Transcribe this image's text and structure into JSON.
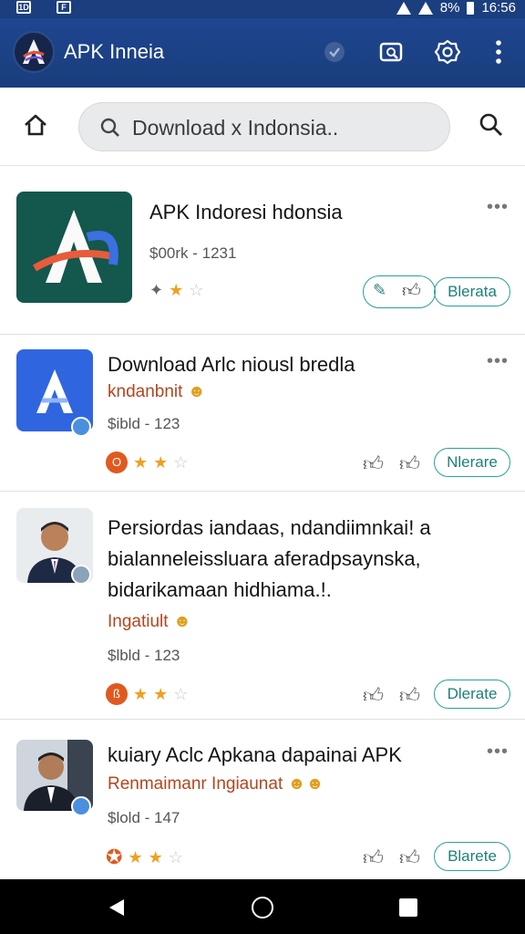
{
  "status_bar": {
    "left_icon_1": "1D",
    "left_icon_2": "F",
    "battery": "8%",
    "time": "16:56"
  },
  "app_bar": {
    "title": "APK Inneia",
    "icons": [
      "shield-check-icon",
      "screenshot-icon",
      "settings-icon",
      "more-vert-icon"
    ]
  },
  "search": {
    "text": "Download х Indonsia.."
  },
  "items": [
    {
      "title": "APK Indoresi hdonsia",
      "subtitle": "",
      "meta": "$00rk - 1231",
      "stars": 2,
      "button": "Blerata",
      "colors": {
        "thumb_bg": "#14574c"
      }
    },
    {
      "title": "Download Arlc niousl bredla",
      "subtitle": "kndanbnit",
      "meta": "$ibld - 123",
      "stars": 2,
      "button": "Nlerare",
      "colors": {
        "thumb_bg": "#2f66e0"
      }
    },
    {
      "title_lines": [
        "Persiordas iandaas, ndandiimnkai! a",
        "bialanneleissluara aferadpsaynska,",
        "bidarikamaan hidhiama.!."
      ],
      "subtitle": "Ingatiult",
      "meta": "$lbld - 123",
      "stars": 2,
      "button": "Dlerate"
    },
    {
      "title": "kuiary Aclc Apkana dapainai APK",
      "subtitle": "Renmaimanr Ingiaunat",
      "meta": "$lold - 147",
      "stars": 2,
      "button": "Blarete"
    }
  ],
  "colors": {
    "appbar": "#1b3f7e",
    "accent": "#2aa198",
    "subtitle": "#b3451e",
    "star": "#f0a020"
  }
}
